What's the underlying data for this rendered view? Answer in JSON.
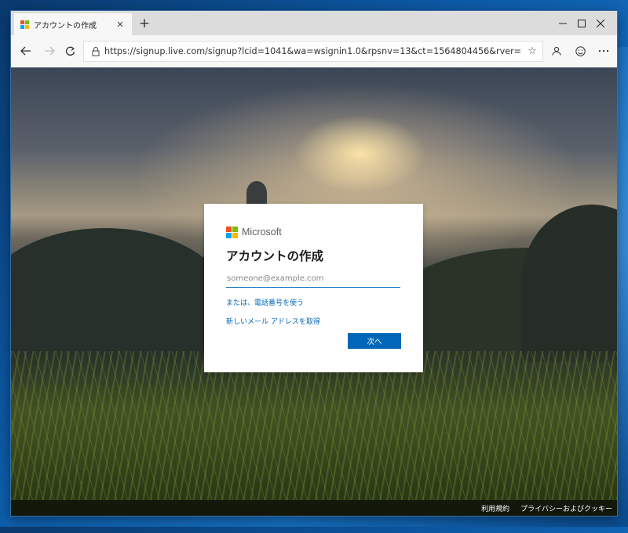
{
  "browser": {
    "tab_title": "アカウントの作成",
    "tab_close": "✕",
    "new_tab": "+",
    "url": "https://signup.live.com/signup?lcid=1041&wa=wsignin1.0&rpsnv=13&ct=1564804456&rver=7.0.6738.0&wp=MBI_S...",
    "icons": [
      "back-icon",
      "forward-icon",
      "refresh-icon",
      "lock-icon",
      "favorite-star-icon",
      "profile-icon",
      "feedback-smiley-icon",
      "more-icon"
    ]
  },
  "brand": {
    "name": "Microsoft",
    "colors": [
      "#f25022",
      "#7fba00",
      "#00a4ef",
      "#ffb900"
    ]
  },
  "dialog": {
    "title": "アカウントの作成",
    "email_placeholder": "someone@example.com",
    "email_value": "",
    "phone_link": "または、電話番号を使う",
    "new_email_link": "新しいメール アドレスを取得",
    "next_button": "次へ"
  },
  "footer": {
    "terms": "利用規約",
    "privacy": "プライバシーおよびクッキー"
  },
  "colors": {
    "accent": "#0067b8"
  }
}
